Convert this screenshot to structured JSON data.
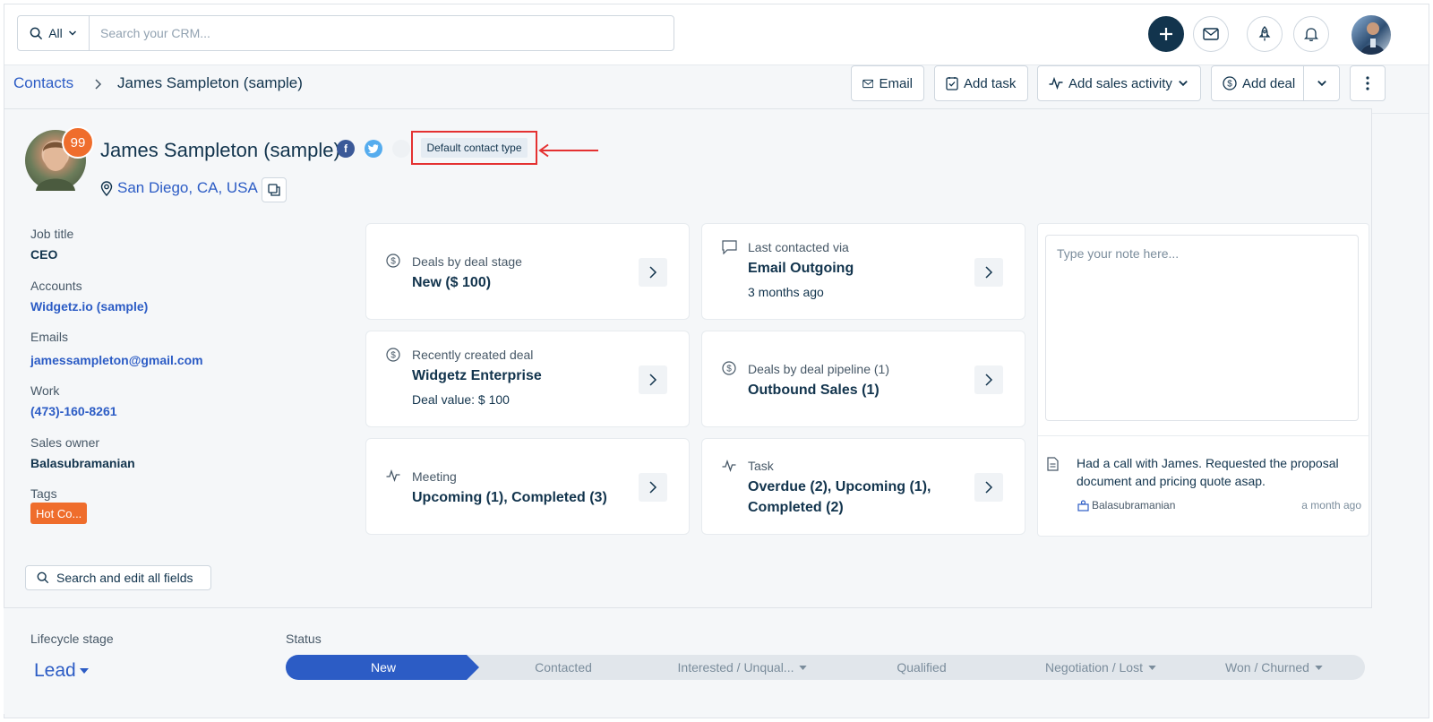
{
  "topbar": {
    "scope_label": "All",
    "search_placeholder": "Search your CRM..."
  },
  "breadcrumb": {
    "parent": "Contacts",
    "current": "James Sampleton (sample)"
  },
  "toolbar": {
    "email_label": "Email",
    "add_task_label": "Add task",
    "add_sales_activity_label": "Add sales activity",
    "add_deal_label": "Add deal"
  },
  "contact": {
    "score": "99",
    "name": "James Sampleton (sample)",
    "contact_type": "Default contact type",
    "location": "San Diego, CA, USA"
  },
  "fields": [
    {
      "label": "Job title",
      "value": "CEO",
      "link": false
    },
    {
      "label": "Accounts",
      "value": "Widgetz.io (sample)",
      "link": true
    },
    {
      "label": "Emails",
      "value": "jamessampleton@gmail.com",
      "link": true
    },
    {
      "label": "Work",
      "value": "(473)-160-8261",
      "link": true
    },
    {
      "label": "Sales owner",
      "value": "Balasubramanian",
      "link": false
    }
  ],
  "tags": {
    "label": "Tags",
    "value": "Hot Co..."
  },
  "edit_fields_label": "Search and edit all fields",
  "cards": {
    "deal_stage": {
      "title": "Deals by deal stage",
      "value": "New ($ 100)"
    },
    "last_contacted": {
      "title": "Last contacted via",
      "value": "Email Outgoing",
      "sub": "3 months ago"
    },
    "recent_deal": {
      "title": "Recently created deal",
      "value": "Widgetz Enterprise",
      "sub": "Deal value: $ 100"
    },
    "deal_pipeline": {
      "title": "Deals by deal pipeline (1)",
      "value": "Outbound Sales (1)"
    },
    "meeting": {
      "title": "Meeting",
      "value": "Upcoming (1), Completed (3)"
    },
    "task": {
      "title": "Task",
      "value": "Overdue (2), Upcoming (1), Completed (2)"
    }
  },
  "notes": {
    "placeholder": "Type your note here...",
    "text": "Had a call with James. Requested the proposal document and pricing quote asap.",
    "author": "Balasubramanian",
    "time": "a month ago"
  },
  "lifecycle": {
    "label": "Lifecycle stage",
    "value": "Lead",
    "status_label": "Status",
    "stages": [
      "New",
      "Contacted",
      "Interested / Unqual...",
      "Qualified",
      "Negotiation / Lost",
      "Won / Churned"
    ]
  },
  "colors": {
    "brand_blue": "#2c5cc5",
    "navy": "#12344d",
    "accent_orange": "#ef6d2c",
    "highlight_red": "#e43131"
  }
}
